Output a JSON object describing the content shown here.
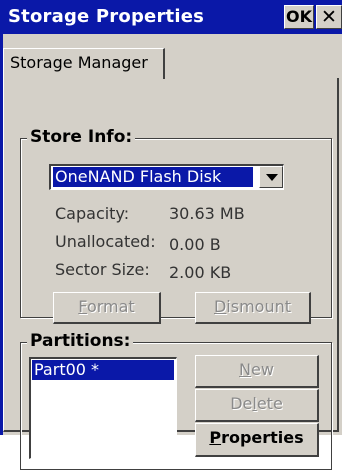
{
  "window": {
    "title": "Storage Properties",
    "ok_label": "OK",
    "close_label": "✕"
  },
  "tabs": [
    {
      "label": "Storage Manager"
    }
  ],
  "store_info": {
    "label": "Store Info:",
    "selected_store": "OneNAND Flash Disk",
    "capacity_label": "Capacity:",
    "capacity_value": "30.63 MB",
    "unallocated_label": "Unallocated:",
    "unallocated_value": "0.00 B",
    "sector_size_label": "Sector Size:",
    "sector_size_value": "2.00 KB",
    "format_label": "Format",
    "dismount_label": "Dismount"
  },
  "partitions": {
    "label": "Partitions:",
    "items": [
      "Part00 *"
    ],
    "new_label": "New",
    "delete_label": "Delete",
    "properties_label": "Properties"
  },
  "colors": {
    "titlebar": "#0a18a8",
    "panel": "#d4d0c8",
    "selection": "#0a18a8"
  }
}
